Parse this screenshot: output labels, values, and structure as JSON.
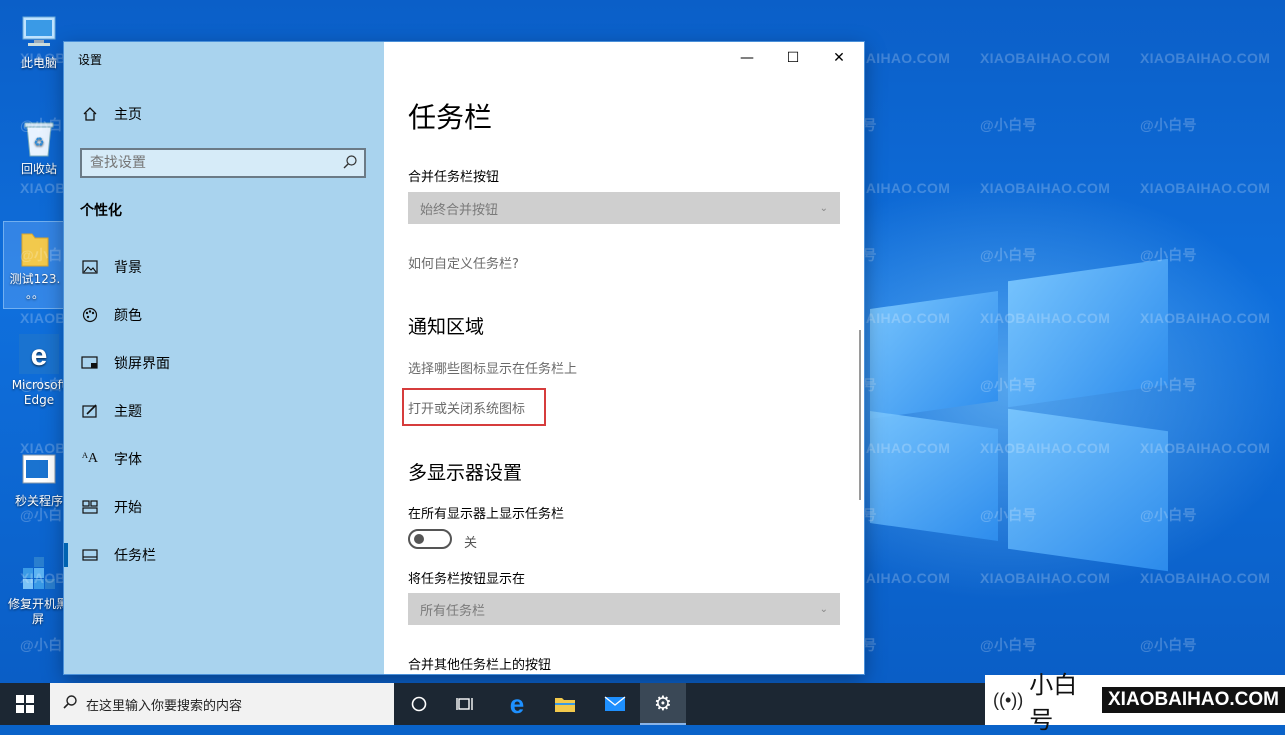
{
  "desktop": {
    "icons": [
      {
        "label": "此电脑",
        "icon": "computer-icon"
      },
      {
        "label": "回收站",
        "icon": "recycle-bin-icon"
      },
      {
        "label": "测试123.",
        "sub": "。。",
        "icon": "folder-icon"
      },
      {
        "label": "Microsoft Edge",
        "icon": "edge-icon"
      },
      {
        "label": "秒关程序",
        "icon": "app-shortcut-icon"
      },
      {
        "label": "修复开机黑屏",
        "icon": "repair-icon"
      }
    ],
    "watermark_text": "XIAOBAIHAO.COM",
    "watermark_logo": "@小白号"
  },
  "settings": {
    "window_title": "设置",
    "controls": {
      "minimize": "—",
      "maximize": "☐",
      "close": "✕"
    },
    "sidebar": {
      "home": "主页",
      "search_placeholder": "查找设置",
      "section": "个性化",
      "items": [
        {
          "label": "背景",
          "icon": "background-icon"
        },
        {
          "label": "颜色",
          "icon": "palette-icon"
        },
        {
          "label": "锁屏界面",
          "icon": "lock-screen-icon"
        },
        {
          "label": "主题",
          "icon": "theme-icon"
        },
        {
          "label": "字体",
          "icon": "font-icon"
        },
        {
          "label": "开始",
          "icon": "start-icon"
        },
        {
          "label": "任务栏",
          "icon": "taskbar-icon",
          "active": true
        }
      ]
    },
    "content": {
      "title": "任务栏",
      "combine_label": "合并任务栏按钮",
      "combine_value": "始终合并按钮",
      "customize_link": "如何自定义任务栏?",
      "notify_title": "通知区域",
      "select_icons_link": "选择哪些图标显示在任务栏上",
      "system_icons_link": "打开或关闭系统图标",
      "multi_title": "多显示器设置",
      "show_all_label": "在所有显示器上显示任务栏",
      "toggle_state": "关",
      "toggle_on": false,
      "show_buttons_label": "将任务栏按钮显示在",
      "show_buttons_value": "所有任务栏",
      "combine_other_label": "合并其他任务栏上的按钮"
    }
  },
  "taskbar": {
    "search_placeholder": "在这里输入你要搜索的内容",
    "pinned": [
      "cortana-icon",
      "task-view-icon",
      "edge-icon",
      "file-explorer-icon",
      "mail-icon",
      "settings-icon"
    ]
  },
  "brand": {
    "name": "小白号",
    "domain": "XIAOBAIHAO.COM"
  },
  "colors": {
    "accent": "#0063b1",
    "sidebar": "#a9d3ee",
    "highlight": "#d63c3c",
    "taskbar": "#1c2733"
  }
}
